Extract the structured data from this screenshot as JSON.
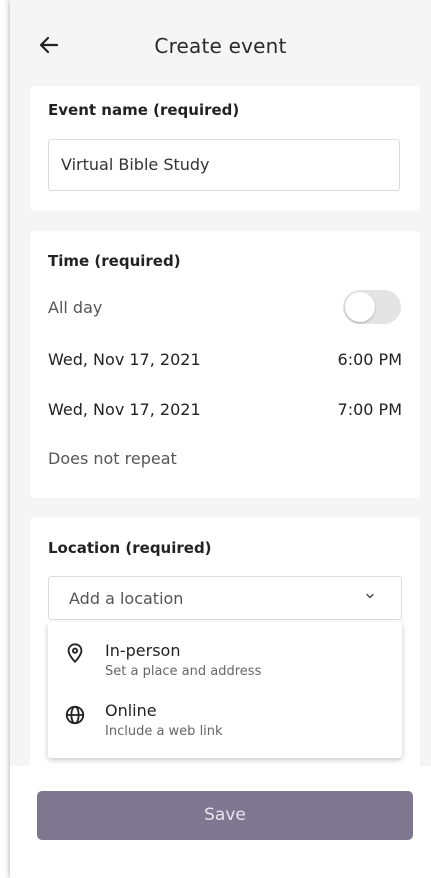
{
  "header": {
    "title": "Create event",
    "back_icon": "arrow-left-icon"
  },
  "event_name": {
    "label": "Event name (required)",
    "value": "Virtual Bible Study"
  },
  "time": {
    "label": "Time (required)",
    "all_day_label": "All day",
    "all_day_enabled": false,
    "start_date": "Wed, Nov 17, 2021",
    "start_time": "6:00 PM",
    "end_date": "Wed, Nov 17, 2021",
    "end_time": "7:00 PM",
    "repeat": "Does not repeat"
  },
  "location": {
    "label": "Location (required)",
    "placeholder": "Add a location",
    "chevron_icon": "chevron-down-icon",
    "options": [
      {
        "title": "In-person",
        "subtitle": "Set a place and address",
        "icon": "map-pin-icon"
      },
      {
        "title": "Online",
        "subtitle": "Include a web link",
        "icon": "globe-icon"
      }
    ]
  },
  "footer": {
    "save_label": "Save"
  },
  "colors": {
    "background": "#f5f5f5",
    "card": "#ffffff",
    "save_button": "#7f778f",
    "save_text": "#e9e6f0",
    "toggle_off": "#e4e4e4"
  }
}
